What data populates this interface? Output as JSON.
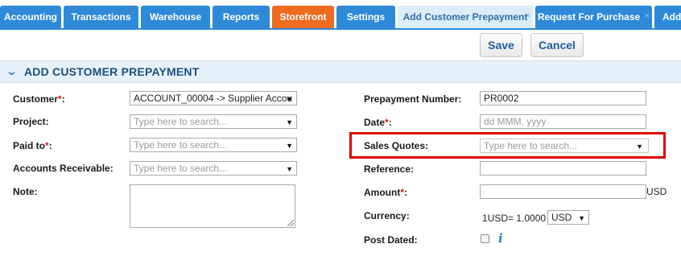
{
  "tabs": [
    {
      "label": "Accounting",
      "state": "normal"
    },
    {
      "label": "Transactions",
      "state": "normal"
    },
    {
      "label": "Warehouse",
      "state": "normal"
    },
    {
      "label": "Reports",
      "state": "normal"
    },
    {
      "label": "Storefront",
      "state": "highlight"
    },
    {
      "label": "Settings",
      "state": "normal"
    },
    {
      "label": "Add Customer Prepayment",
      "state": "active",
      "close": "×"
    },
    {
      "label": "Request For Purchase",
      "state": "normal",
      "close": "×"
    },
    {
      "label": "Add",
      "state": "normal"
    }
  ],
  "toolbar": {
    "save_label": "Save",
    "cancel_label": "Cancel"
  },
  "section": {
    "title": "ADD CUSTOMER PREPAYMENT"
  },
  "left": {
    "customer": {
      "label": "Customer",
      "required": "*",
      "colon": ":",
      "value": "ACCOUNT_00004 -> Supplier Accou"
    },
    "project": {
      "label": "Project:",
      "placeholder": "Type here to search..."
    },
    "paid_to": {
      "label": "Paid to",
      "required": "*",
      "colon": ":",
      "placeholder": "Type here to search..."
    },
    "accounts_receivable": {
      "label": "Accounts Receivable:",
      "placeholder": "Type here to search..."
    },
    "note": {
      "label": "Note:"
    }
  },
  "right": {
    "prepayment_number": {
      "label": "Prepayment Number:",
      "value": "PR0002"
    },
    "date": {
      "label": "Date",
      "required": "*",
      "colon": ":",
      "placeholder": "dd MMM, yyyy"
    },
    "sales_quotes": {
      "label": "Sales Quotes:",
      "placeholder": "Type here to search..."
    },
    "reference": {
      "label": "Reference:"
    },
    "amount": {
      "label": "Amount",
      "required": "*",
      "colon": ":",
      "unit": "USD"
    },
    "currency": {
      "label": "Currency:",
      "rate_text": "1USD= 1.0000",
      "selected": "USD"
    },
    "post_dated": {
      "label": "Post Dated:"
    }
  },
  "colors": {
    "tab_blue": "#2e8ad8",
    "tab_orange": "#ef6b1f",
    "highlight_red": "#e00000",
    "required_red": "#d21414"
  }
}
